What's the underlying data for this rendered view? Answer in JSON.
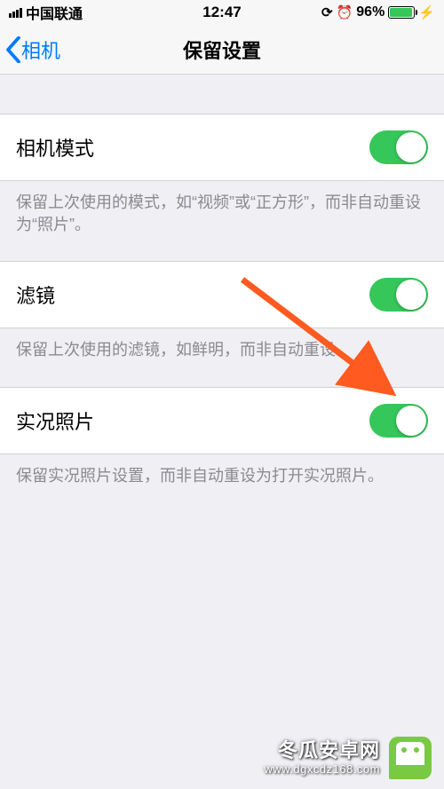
{
  "status": {
    "carrier": "中国联通",
    "time": "12:47",
    "battery_pct": "96%"
  },
  "nav": {
    "back_label": "相机",
    "title": "保留设置"
  },
  "rows": {
    "camera_mode": {
      "label": "相机模式",
      "footer": "保留上次使用的模式，如“视频”或“正方形”，而非自动重设为“照片”。",
      "on": true
    },
    "filter": {
      "label": "滤镜",
      "footer": "保留上次使用的滤镜，如鲜明，而非自动重设。",
      "on": true
    },
    "live_photo": {
      "label": "实况照片",
      "footer": "保留实况照片设置，而非自动重设为打开实况照片。",
      "on": true
    }
  },
  "watermark": {
    "line1": "冬瓜安卓网",
    "line2": "www.dgxcdz168.com"
  }
}
